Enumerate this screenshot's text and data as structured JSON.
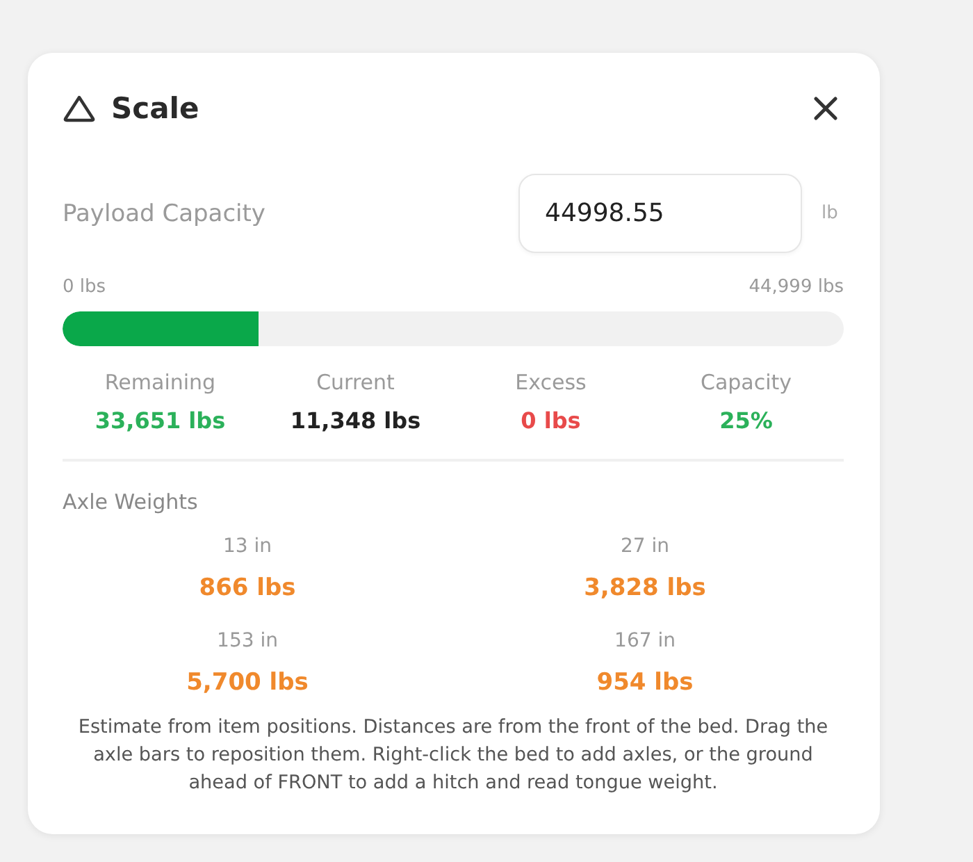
{
  "panel": {
    "title": "Scale"
  },
  "payload": {
    "label": "Payload Capacity",
    "value": "44998.55",
    "unit": "lb"
  },
  "range": {
    "min_label": "0 lbs",
    "max_label": "44,999 lbs",
    "level": 0.25
  },
  "stats": [
    {
      "label": "Remaining",
      "value": "33,651 lbs",
      "color": "#2bb15a"
    },
    {
      "label": "Current",
      "value": "11,348 lbs",
      "color": "#222222"
    },
    {
      "label": "Excess",
      "value": "0 lbs",
      "color": "#e84a4a"
    },
    {
      "label": "Capacity",
      "value": "25%",
      "color": "#2bb15a"
    }
  ],
  "axle_weights": {
    "title": "Axle Weights",
    "axles": [
      {
        "position": "13 in",
        "weight": "866 lbs"
      },
      {
        "position": "27 in",
        "weight": "3,828 lbs"
      },
      {
        "position": "153 in",
        "weight": "5,700 lbs"
      },
      {
        "position": "167 in",
        "weight": "954 lbs"
      }
    ]
  },
  "note": "Estimate from item positions. Distances are from the front of the bed. Drag the axle bars to reposition them. Right-click the bed to add axles, or the ground ahead of FRONT to add a hitch and read tongue weight."
}
